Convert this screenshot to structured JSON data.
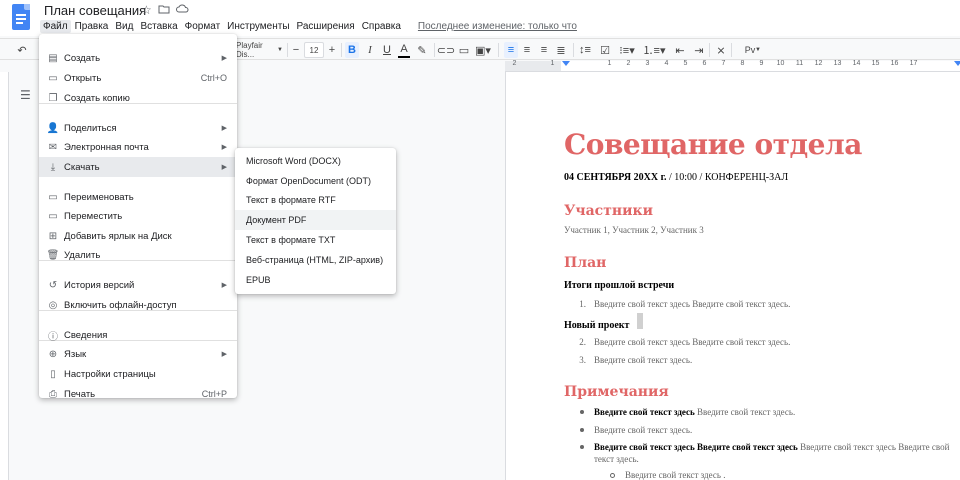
{
  "header": {
    "doc_title": "План совещания",
    "last_edit": "Последнее изменение: только что"
  },
  "menubar": [
    "Файл",
    "Правка",
    "Вид",
    "Вставка",
    "Формат",
    "Инструменты",
    "Расширения",
    "Справка"
  ],
  "toolbar": {
    "font": "Playfair Dis...",
    "font_size": "12",
    "style_label": "Pv"
  },
  "ruler_numbers": [
    "2",
    "",
    "1",
    "",
    "",
    "1",
    "2",
    "3",
    "4",
    "5",
    "6",
    "7",
    "8",
    "9",
    "10",
    "11",
    "12",
    "13",
    "14",
    "15",
    "16",
    "17"
  ],
  "file_menu": {
    "items": [
      {
        "icon": "create-icon",
        "label": "Создать",
        "shortcut": "",
        "arrow": true
      },
      {
        "icon": "open-icon",
        "label": "Открыть",
        "shortcut": "Ctrl+O",
        "arrow": false
      },
      {
        "icon": "copy-icon",
        "label": "Создать копию",
        "shortcut": "",
        "arrow": false
      },
      {
        "icon": "share-icon",
        "label": "Поделиться",
        "shortcut": "",
        "arrow": true
      },
      {
        "icon": "email-icon",
        "label": "Электронная почта",
        "shortcut": "",
        "arrow": true
      },
      {
        "icon": "download-icon",
        "label": "Скачать",
        "shortcut": "",
        "arrow": true
      },
      {
        "icon": "rename-icon",
        "label": "Переименовать",
        "shortcut": "",
        "arrow": false
      },
      {
        "icon": "move-icon",
        "label": "Переместить",
        "shortcut": "",
        "arrow": false
      },
      {
        "icon": "drive-shortcut-icon",
        "label": "Добавить ярлык на Диск",
        "shortcut": "",
        "arrow": false
      },
      {
        "icon": "trash-icon",
        "label": "Удалить",
        "shortcut": "",
        "arrow": false
      },
      {
        "icon": "history-icon",
        "label": "История версий",
        "shortcut": "",
        "arrow": true
      },
      {
        "icon": "offline-icon",
        "label": "Включить офлайн-доступ",
        "shortcut": "",
        "arrow": false
      },
      {
        "icon": "info-icon",
        "label": "Сведения",
        "shortcut": "",
        "arrow": false
      },
      {
        "icon": "globe-icon",
        "label": "Язык",
        "shortcut": "",
        "arrow": true
      },
      {
        "icon": "page-setup-icon",
        "label": "Настройки страницы",
        "shortcut": "",
        "arrow": false
      },
      {
        "icon": "print-icon",
        "label": "Печать",
        "shortcut": "Ctrl+P",
        "arrow": false
      }
    ],
    "highlighted": "Скачать"
  },
  "download_submenu": {
    "items": [
      "Microsoft Word (DOCX)",
      "Формат OpenDocument (ODT)",
      "Текст в формате RTF",
      "Документ PDF",
      "Текст в формате TXT",
      "Веб-страница (HTML, ZIP-архив)",
      "EPUB"
    ],
    "highlighted": "Документ PDF"
  },
  "document": {
    "title": "Совещание отдела",
    "date_bold": "04 СЕНТЯБРЯ 20ХХ г.",
    "date_rest": " / 10:00 / КОНФЕРЕНЦ-ЗАЛ",
    "participants_heading": "Участники",
    "participants_text": "Участник 1, Участник 2, Участник 3",
    "plan_heading": "План",
    "prev_meeting_heading": "Итоги прошлой встречи",
    "list1": [
      {
        "n": "1.",
        "text": "Введите свой текст здесь Введите свой текст здесь."
      }
    ],
    "new_project_heading": "Новый проект",
    "list2": [
      {
        "n": "2.",
        "text": "Введите свой текст здесь Введите свой текст здесь."
      },
      {
        "n": "3.",
        "text": "Введите свой текст здесь."
      }
    ],
    "notes_heading": "Примечания",
    "bullets": [
      {
        "bold": "Введите свой текст здесь",
        "text": " Введите свой текст здесь."
      },
      {
        "bold": "",
        "text": "Введите свой текст здесь."
      },
      {
        "bold": "Введите свой текст здесь Введите свой текст здесь",
        "text": " Введите свой текст здесь Введите свой текст здесь."
      }
    ],
    "sub_bullet": "Введите свой текст здесь ."
  },
  "colors": {
    "heading_accent": "#e06666",
    "brand_blue": "#4285f4",
    "active_blue": "#1a73e8"
  }
}
